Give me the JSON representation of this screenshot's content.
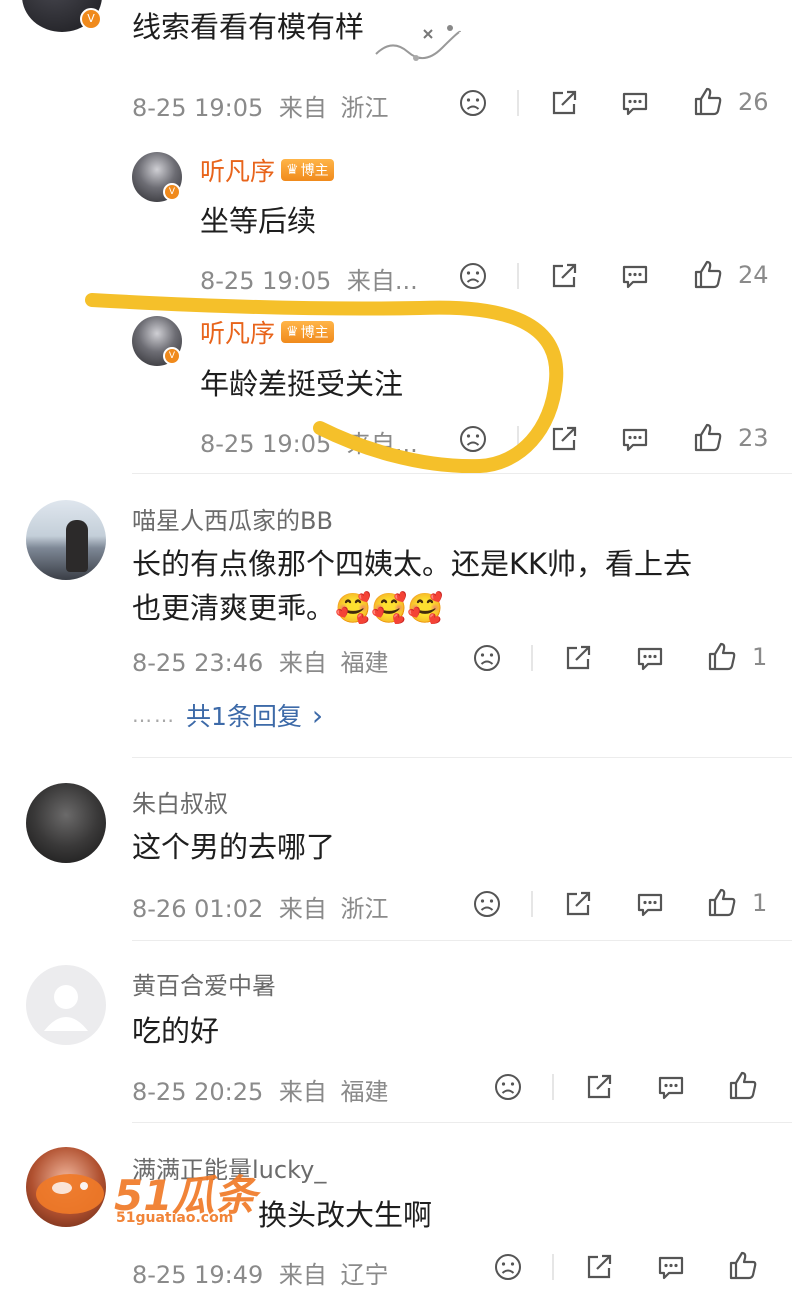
{
  "comments": [
    {
      "content": "线索看看有模有样",
      "time": "8-25 19:05",
      "from": "来自",
      "region": "浙江",
      "likes": "26",
      "replies": [
        {
          "name": "听凡序",
          "badge": "博主",
          "content": "坐等后续",
          "time": "8-25 19:05",
          "from": "来自...",
          "likes": "24"
        },
        {
          "name": "听凡序",
          "badge": "博主",
          "content": "年龄差挺受关注",
          "time": "8-25 19:05",
          "from": "来自...",
          "likes": "23"
        }
      ]
    },
    {
      "name": "喵星人西瓜家的BB",
      "content_line1": "长的有点像那个四姨太。还是KK帅，看上去",
      "content_line2": "也更清爽更乖。🥰🥰🥰",
      "time": "8-25 23:46",
      "from": "来自",
      "region": "福建",
      "likes": "1",
      "reply_dots": "……",
      "reply_summary": "共1条回复",
      "reply_arrow": "›"
    },
    {
      "name": "朱白叔叔",
      "content": "这个男的去哪了",
      "time": "8-26 01:02",
      "from": "来自",
      "region": "浙江",
      "likes": "1"
    },
    {
      "name": "黄百合爱中暑",
      "content": "吃的好",
      "time": "8-25 20:25",
      "from": "来自",
      "region": "福建"
    },
    {
      "name": "满满正能量lucky_",
      "content": "换头改大生啊",
      "time": "8-25 19:49",
      "from": "来自",
      "region": "辽宁"
    }
  ],
  "watermark": {
    "brand": "51瓜条",
    "url": "51guatiao.com"
  },
  "colors": {
    "highlight_stroke": "#f5c02a",
    "name_vip": "#e8641b",
    "link": "#3d6aa8"
  }
}
